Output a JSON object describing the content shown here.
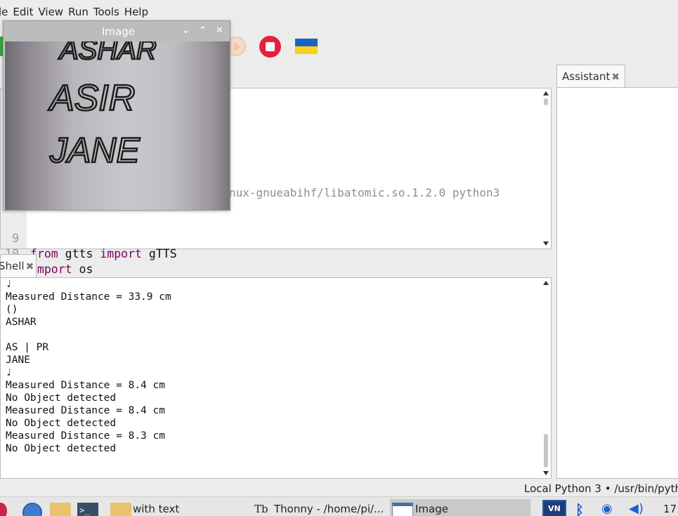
{
  "menu": [
    "le",
    "Edit",
    "View",
    "Run",
    "Tools",
    "Help"
  ],
  "image_window": {
    "title": "Image",
    "photo_words": [
      "ASHAR",
      "ASIR",
      "JANE"
    ]
  },
  "editor": {
    "comment_fragment": "nux-gnueabihf/libatomic.so.1.2.0 python3",
    "lines": [
      {
        "num": "9",
        "kw": "from",
        "mid": " gtts ",
        "kw2": "import",
        "rest": " gTTS"
      },
      {
        "num": "10",
        "kw": "import",
        "rest": " os"
      }
    ]
  },
  "shell": {
    "tab_label": "Shell",
    "output": "♩\nMeasured Distance = 33.9 cm\n()\nASHAR\n\nAS | PR\nJANE\n♩\nMeasured Distance = 8.4 cm\nNo Object detected\nMeasured Distance = 8.4 cm\nNo Object detected\nMeasured Distance = 8.3 cm\nNo Object detected"
  },
  "assistant": {
    "tab_label": "Assistant"
  },
  "status": {
    "interpreter": "Local Python 3 • /usr/bin/pyth"
  },
  "taskbar": {
    "folder_label": "with text",
    "thonny_label": "Thonny  -  /home/pi/...",
    "image_label": "Image",
    "clock": "17:"
  }
}
